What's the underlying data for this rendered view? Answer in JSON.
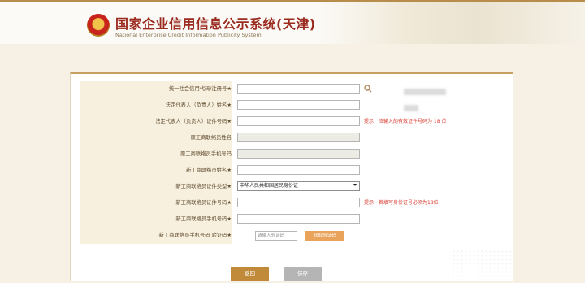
{
  "header": {
    "title_cn": "国家企业信用信息公示系统(天津)",
    "title_en": "National Enterprise Credit Information Publicity System"
  },
  "form": {
    "rows": [
      {
        "label": "统一社会信用代码/注册号★",
        "type": "input",
        "value": "",
        "placeholder": ""
      },
      {
        "label": "法定代表人（负责人）姓名★",
        "type": "input",
        "value": "",
        "placeholder": ""
      },
      {
        "label": "法定代表人（负责人）证件号码★",
        "type": "input",
        "value": "",
        "hint": "提示：应输入的有效证件号码为 18 位"
      },
      {
        "label": "原工商联络员姓名",
        "type": "disabled",
        "value": ""
      },
      {
        "label": "原工商联络员手机号码",
        "type": "disabled",
        "value": ""
      },
      {
        "label": "新工商联络员姓名★",
        "type": "input",
        "value": ""
      },
      {
        "label": "新工商联络员证件类型★",
        "type": "select",
        "value": "中华人民共和国居民身份证"
      },
      {
        "label": "新工商联络员证件号码★",
        "type": "input",
        "value": "",
        "hint": "提示：若填写身份证号必须为18位"
      },
      {
        "label": "新工商联络员手机号码★",
        "type": "input",
        "value": ""
      },
      {
        "label": "新工商联络员手机号码  验证码★",
        "type": "captcha",
        "placeholder": "请输入验证码",
        "button": "获取验证码"
      }
    ]
  },
  "buttons": {
    "back": "返回",
    "save": "保存"
  },
  "colors": {
    "brand": "#9b2a1f",
    "accent": "#c08a3a",
    "hint": "#d83b30"
  }
}
